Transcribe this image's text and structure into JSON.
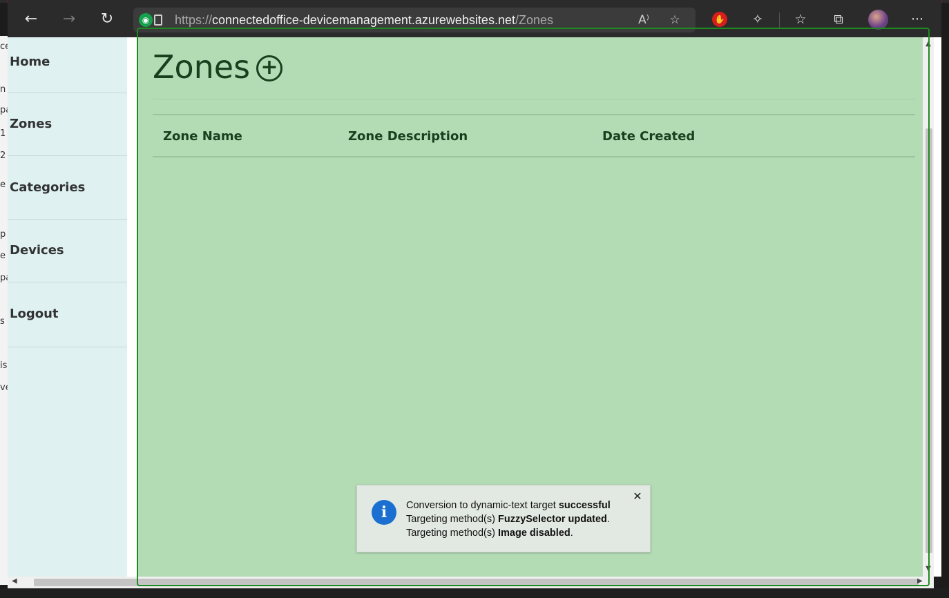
{
  "browser": {
    "url_prefix": "https://",
    "url_host": "connectedoffice-devicemanagement.azurewebsites.net",
    "url_path": "/Zones",
    "icons": [
      "back-icon",
      "forward-icon",
      "refresh-icon",
      "site-info-icon",
      "lock-icon",
      "read-aloud-icon",
      "add-favorite-icon",
      "stop-icon",
      "extensions-icon",
      "favorites-icon",
      "collections-icon",
      "avatar",
      "more-icon"
    ]
  },
  "left_edge_fragments": [
    "ce",
    "n",
    "pa",
    "1",
    "2",
    "e",
    "p",
    "e",
    "pa",
    "s",
    "is",
    "ve"
  ],
  "sidebar": {
    "items": [
      {
        "label": "Home"
      },
      {
        "label": "Zones"
      },
      {
        "label": "Categories"
      },
      {
        "label": "Devices"
      },
      {
        "label": "Logout"
      }
    ]
  },
  "main": {
    "title": "Zones",
    "table": {
      "headers": [
        "Zone Name",
        "Zone Description",
        "Date Created"
      ],
      "rows": []
    }
  },
  "toast": {
    "line1_prefix": "Conversion to dynamic-text target ",
    "line1_bold": "successful",
    "line2_prefix": "Targeting method(s) ",
    "line2_bold": "FuzzySelector updated",
    "line2_suffix": ".",
    "line3_prefix": "Targeting method(s) ",
    "line3_bold": "Image disabled",
    "line3_suffix": "."
  },
  "colors": {
    "overlay": "#b3dcb4",
    "highlight_border": "#1f8a1f",
    "sidebar_bg": "#dff1f1",
    "info_blue": "#1a6fd1",
    "stop_red": "#d71d1d"
  }
}
